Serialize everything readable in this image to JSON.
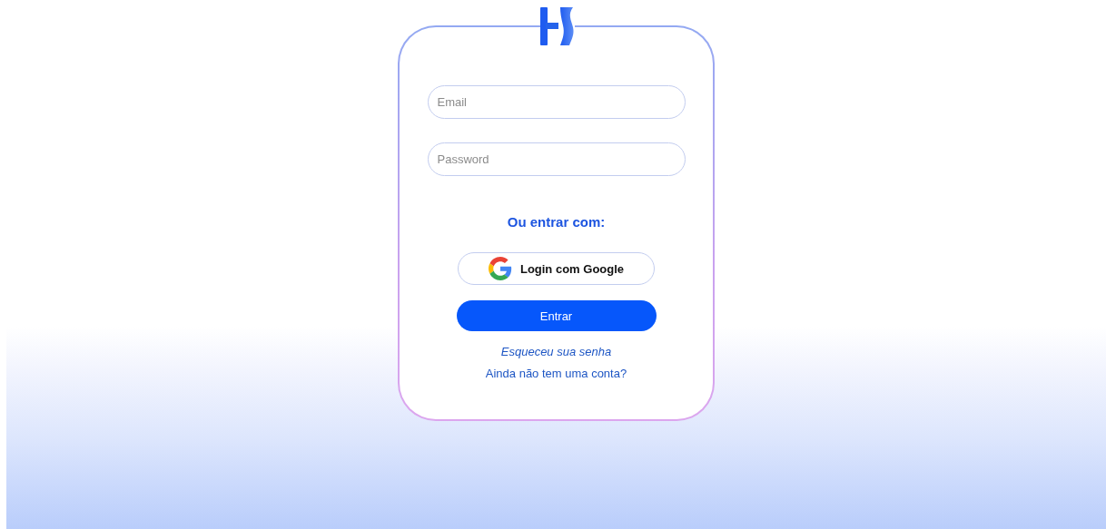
{
  "login_form": {
    "email": {
      "placeholder": "Email"
    },
    "password": {
      "placeholder": "Password"
    },
    "alt_heading": "Ou entrar com:",
    "google_button": "Login com Google",
    "submit_button": "Entrar",
    "forgot_link": "Esqueceu sua senha",
    "signup_link": "Ainda não tem uma conta?"
  }
}
